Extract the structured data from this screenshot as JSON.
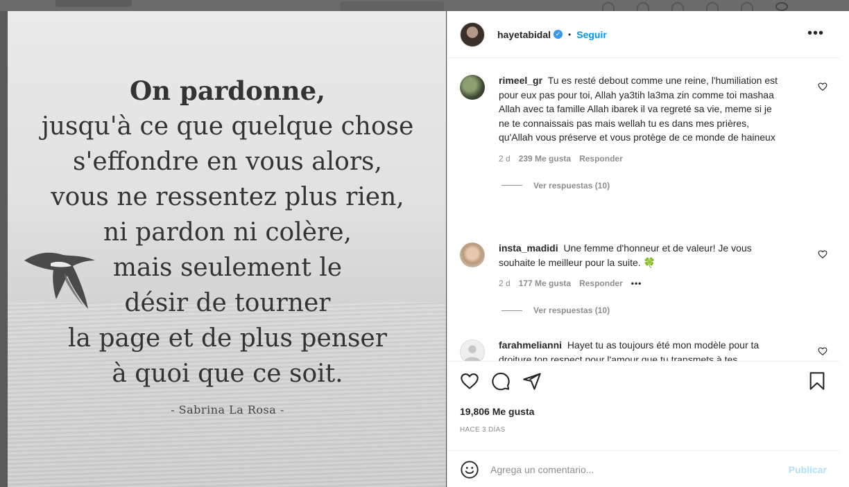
{
  "post": {
    "quote_lines": [
      "On pardonne,",
      "jusqu'à ce que quelque chose",
      "s'effondre en vous alors,",
      "vous ne ressentez plus rien,",
      "ni pardon ni colère,",
      "mais seulement le",
      "désir de tourner",
      "la page et de plus penser",
      "à quoi que ce soit."
    ],
    "signature": "- Sabrina La Rosa -"
  },
  "header": {
    "username": "hayetabidal",
    "separator": "•",
    "follow_label": "Seguir",
    "more_label": "•••"
  },
  "comments": [
    {
      "user": "rimeel_gr",
      "text": "Tu es resté debout comme une reine, l'humiliation est pour eux pas pour toi, Allah ya3tih la3ma zin comme toi mashaa Allah avec ta famille Allah ibarek il va regreté sa vie, meme si je ne te connaissais pas mais wellah tu es dans mes prières, qu'Allah vous préserve et vous protège de ce monde de haineux",
      "age": "2 d",
      "likes": "239 Me gusta",
      "reply_label": "Responder",
      "view_replies": "Ver respuestas (10)"
    },
    {
      "user": "insta_madidi",
      "text": "Une femme d'honneur et de valeur! Je vous souhaite le meilleur pour la suite. 🍀",
      "age": "2 d",
      "likes": "177 Me gusta",
      "reply_label": "Responder",
      "more_label": "•••",
      "view_replies": "Ver respuestas (10)"
    },
    {
      "user": "farahmelianni",
      "text": "Hayet tu as toujours été mon modèle pour ta droiture ton respect pour l'amour que tu transmets à tes"
    }
  ],
  "actions": {
    "likes_count": "19,806 Me gusta",
    "time_ago": "HACE 3 DÍAS"
  },
  "comment_box": {
    "placeholder": "Agrega un comentario...",
    "publish_label": "Publicar"
  },
  "colors": {
    "accent": "#0095f6",
    "publish_disabled": "#b2dffc",
    "secondary_text": "#8e8e8e",
    "primary_text": "#262626"
  }
}
